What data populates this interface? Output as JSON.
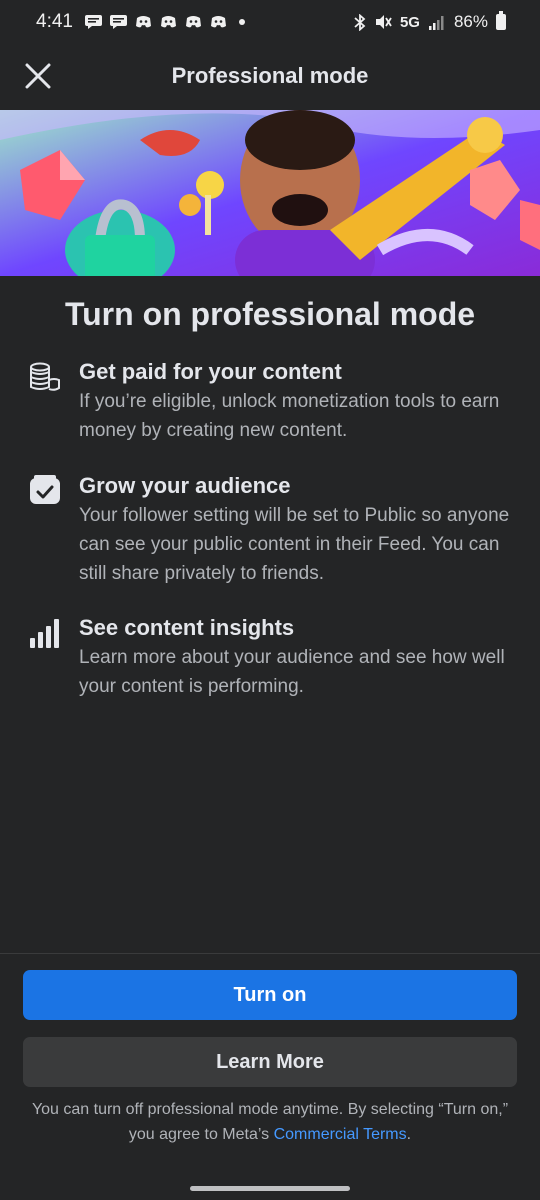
{
  "status_bar": {
    "time": "4:41",
    "network": "5G",
    "battery": "86%"
  },
  "header": {
    "title": "Professional mode"
  },
  "main": {
    "title": "Turn on professional mode",
    "features": [
      {
        "icon": "coins-icon",
        "title": "Get paid for your content",
        "description": "If you’re eligible, unlock monetization tools to earn money by creating new content."
      },
      {
        "icon": "inbox-check-icon",
        "title": "Grow your audience",
        "description": "Your follower setting will be set to Public so anyone can see your public content in their Feed. You can still share privately to friends."
      },
      {
        "icon": "bar-chart-icon",
        "title": "See content insights",
        "description": "Learn more about your audience and see how well your content is performing."
      }
    ]
  },
  "actions": {
    "turn_on_label": "Turn on",
    "learn_more_label": "Learn More"
  },
  "footnote": {
    "text": "You can turn off professional mode anytime. By selecting “Turn on,” you agree to Meta’s",
    "link": "Commercial Terms",
    "end": "."
  },
  "colors": {
    "background": "#242526",
    "primary_button": "#1b74e4",
    "secondary_button": "#3a3b3c",
    "link": "#4599ff"
  }
}
